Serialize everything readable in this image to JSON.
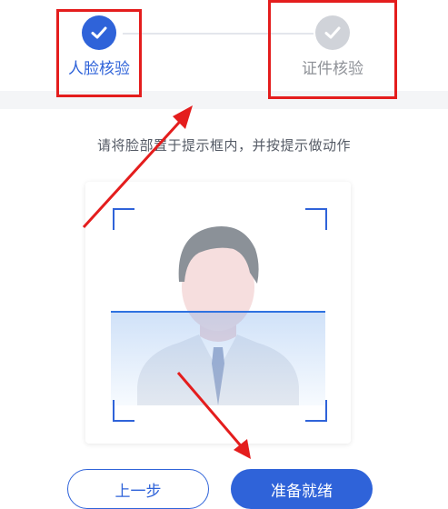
{
  "steps": [
    {
      "label": "人脸核验",
      "status": "done",
      "icon": "check-icon"
    },
    {
      "label": "证件核验",
      "status": "pending",
      "icon": "check-icon"
    }
  ],
  "instruction": "请将脸部置于提示框内，并按提示做动作",
  "buttons": {
    "prev_label": "上一步",
    "ready_label": "准备就绪"
  },
  "colors": {
    "accent": "#2f63d9",
    "inactive": "#d0d3d9",
    "annotation": "#e41d1d"
  }
}
